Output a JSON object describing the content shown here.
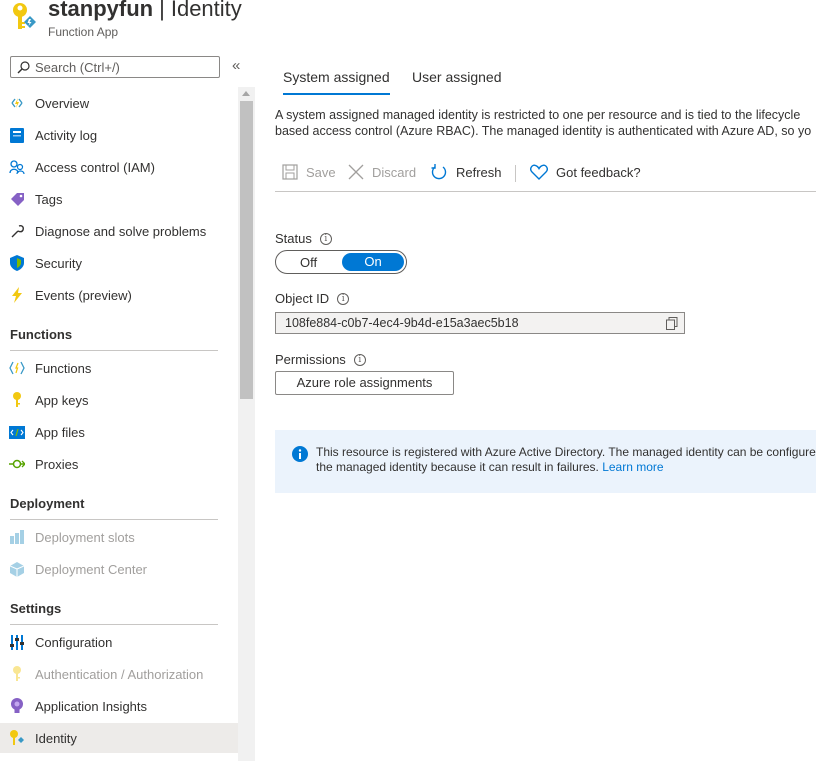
{
  "header": {
    "resource_name": "stanpyfun",
    "separator": "|",
    "page_title": "Identity",
    "subtitle": "Function App"
  },
  "sidebar": {
    "search_placeholder": "Search (Ctrl+/)",
    "collapse_glyph": "«",
    "items": [
      {
        "label": "Overview",
        "icon": "function-bolt-icon",
        "disabled": false
      },
      {
        "label": "Activity log",
        "icon": "activity-log-icon",
        "disabled": false
      },
      {
        "label": "Access control (IAM)",
        "icon": "people-icon",
        "disabled": false
      },
      {
        "label": "Tags",
        "icon": "tag-icon",
        "disabled": false
      },
      {
        "label": "Diagnose and solve problems",
        "icon": "wrench-icon",
        "disabled": false
      },
      {
        "label": "Security",
        "icon": "shield-icon",
        "disabled": false
      },
      {
        "label": "Events (preview)",
        "icon": "lightning-icon",
        "disabled": false
      }
    ],
    "sections": [
      {
        "title": "Functions",
        "items": [
          {
            "label": "Functions",
            "icon": "function-braces-icon",
            "disabled": false
          },
          {
            "label": "App keys",
            "icon": "key-icon",
            "disabled": false
          },
          {
            "label": "App files",
            "icon": "code-file-icon",
            "disabled": false
          },
          {
            "label": "Proxies",
            "icon": "proxy-icon",
            "disabled": false
          }
        ]
      },
      {
        "title": "Deployment",
        "items": [
          {
            "label": "Deployment slots",
            "icon": "deployment-slots-icon",
            "disabled": true
          },
          {
            "label": "Deployment Center",
            "icon": "cube-icon",
            "disabled": true
          }
        ]
      },
      {
        "title": "Settings",
        "items": [
          {
            "label": "Configuration",
            "icon": "sliders-icon",
            "disabled": false
          },
          {
            "label": "Authentication / Authorization",
            "icon": "key-icon",
            "disabled": true
          },
          {
            "label": "Application Insights",
            "icon": "lightbulb-icon",
            "disabled": false
          },
          {
            "label": "Identity",
            "icon": "identity-key-icon",
            "disabled": false,
            "selected": true
          }
        ]
      }
    ]
  },
  "main": {
    "tabs": [
      {
        "label": "System assigned",
        "active": true
      },
      {
        "label": "User assigned",
        "active": false
      }
    ],
    "description_line1": "A system assigned managed identity is restricted to one per resource and is tied to the lifecycle",
    "description_line2": "based access control (Azure RBAC). The managed identity is authenticated with Azure AD, so yo",
    "toolbar": {
      "save": "Save",
      "discard": "Discard",
      "refresh": "Refresh",
      "feedback": "Got feedback?"
    },
    "status": {
      "label": "Status",
      "off": "Off",
      "on": "On",
      "value": "On"
    },
    "object_id": {
      "label": "Object ID",
      "value": "108fe884-c0b7-4ec4-9b4d-e15a3aec5b18"
    },
    "permissions": {
      "label": "Permissions",
      "button": "Azure role assignments"
    },
    "banner": {
      "line1": "This resource is registered with Azure Active Directory. The managed identity can be configured",
      "line2": "the managed identity because it can result in failures.",
      "link": "Learn more"
    }
  },
  "colors": {
    "accent": "#0078d4",
    "banner_bg": "#ebf3fc",
    "selected_bg": "#edebe9"
  }
}
